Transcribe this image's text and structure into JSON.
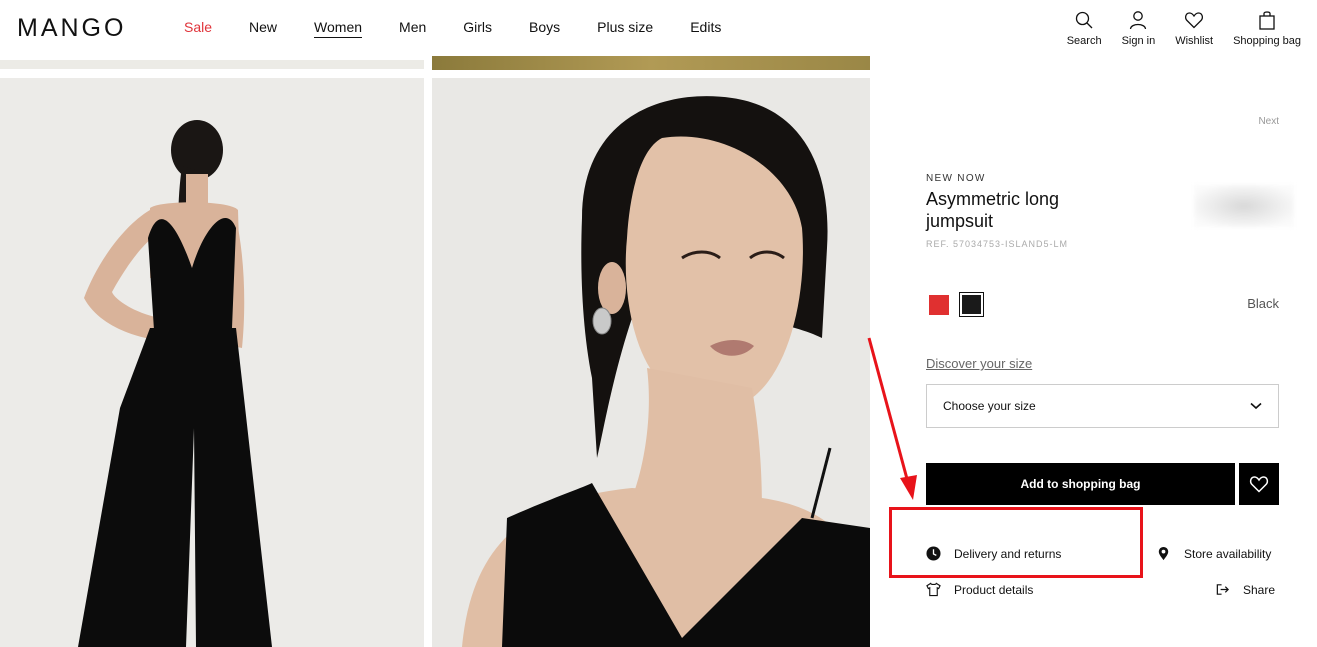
{
  "header": {
    "logo": "MANGO",
    "nav": [
      {
        "label": "Sale"
      },
      {
        "label": "New"
      },
      {
        "label": "Women"
      },
      {
        "label": "Men"
      },
      {
        "label": "Girls"
      },
      {
        "label": "Boys"
      },
      {
        "label": "Plus size"
      },
      {
        "label": "Edits"
      }
    ],
    "utils": {
      "search": "Search",
      "sign_in": "Sign in",
      "wishlist": "Wishlist",
      "bag": "Shopping bag"
    }
  },
  "product": {
    "next": "Next",
    "badge": "NEW NOW",
    "title": "Asymmetric long jumpsuit",
    "ref": "REF. 57034753-ISLAND5-LM",
    "color_selected": "Black",
    "colors": [
      "#e03030",
      "#1a1a1a"
    ],
    "discover_size": "Discover your size",
    "size_placeholder": "Choose your size",
    "add_to_bag": "Add to shopping bag",
    "links": {
      "delivery": "Delivery and returns",
      "store": "Store availability",
      "details": "Product details",
      "share": "Share"
    }
  },
  "colors": {
    "sale": "#e0343b",
    "annotation": "#e8131a"
  }
}
